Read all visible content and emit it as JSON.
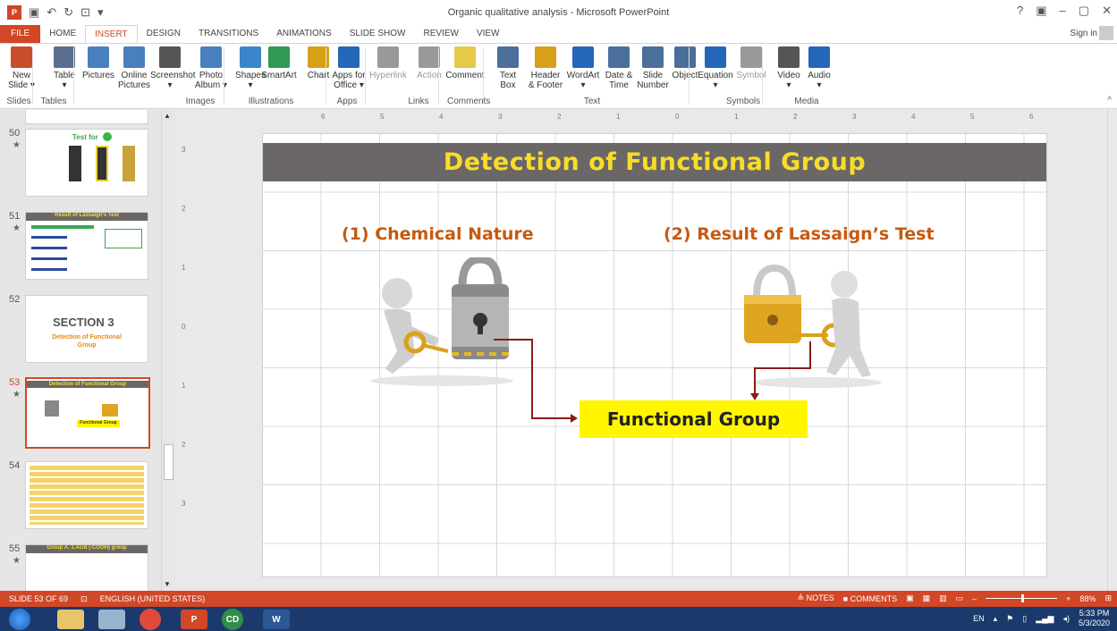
{
  "window": {
    "title": "Organic qualitative analysis - Microsoft PowerPoint",
    "controls": [
      "?",
      "▣",
      "–",
      "▢",
      "✕"
    ]
  },
  "tabs": [
    "FILE",
    "HOME",
    "INSERT",
    "DESIGN",
    "TRANSITIONS",
    "ANIMATIONS",
    "SLIDE SHOW",
    "REVIEW",
    "VIEW"
  ],
  "active_tab": "INSERT",
  "sign_in": "Sign in",
  "ribbon": {
    "buttons": [
      {
        "l1": "New",
        "l2": "Slide ▾",
        "color": "#c94f2a"
      },
      {
        "l1": "Table",
        "l2": "▾",
        "color": "#5a6f8f"
      },
      {
        "l1": "Pictures",
        "l2": "",
        "color": "#4a7fbf"
      },
      {
        "l1": "Online",
        "l2": "Pictures",
        "color": "#4a7fbf"
      },
      {
        "l1": "Screenshot",
        "l2": "▾",
        "color": "#555"
      },
      {
        "l1": "Photo",
        "l2": "Album ▾",
        "color": "#4a7fbf"
      },
      {
        "l1": "Shapes",
        "l2": "▾",
        "color": "#3a86c8"
      },
      {
        "l1": "SmartArt",
        "l2": "",
        "color": "#2e9a55"
      },
      {
        "l1": "Chart",
        "l2": "",
        "color": "#d7a018"
      },
      {
        "l1": "Apps for",
        "l2": "Office ▾",
        "color": "#2466b8"
      },
      {
        "l1": "Hyperlink",
        "l2": "",
        "color": "#999"
      },
      {
        "l1": "Action",
        "l2": "",
        "color": "#999"
      },
      {
        "l1": "Comment",
        "l2": "",
        "color": "#e4c94a"
      },
      {
        "l1": "Text",
        "l2": "Box",
        "color": "#4a6f9a"
      },
      {
        "l1": "Header",
        "l2": "& Footer",
        "color": "#d7a018"
      },
      {
        "l1": "WordArt",
        "l2": "▾",
        "color": "#2466b8"
      },
      {
        "l1": "Date &",
        "l2": "Time",
        "color": "#4a6f9a"
      },
      {
        "l1": "Slide",
        "l2": "Number",
        "color": "#4a6f9a"
      },
      {
        "l1": "Object",
        "l2": "",
        "color": "#4a6f9a"
      },
      {
        "l1": "Equation",
        "l2": "▾",
        "color": "#2466b8"
      },
      {
        "l1": "Symbol",
        "l2": "",
        "color": "#999"
      },
      {
        "l1": "Video",
        "l2": "▾",
        "color": "#555"
      },
      {
        "l1": "Audio",
        "l2": "▾",
        "color": "#2466b8"
      }
    ],
    "groups": [
      "Slides",
      "Tables",
      "Images",
      "Illustrations",
      "Apps",
      "Links",
      "Comments",
      "Text",
      "Symbols",
      "Media"
    ]
  },
  "thumbnails": [
    {
      "number": "50",
      "star": "★",
      "caption": "Test for"
    },
    {
      "number": "51",
      "star": "★",
      "caption": "Result of Lassaign's Test"
    },
    {
      "number": "52",
      "star": "",
      "caption": "SECTION 3"
    },
    {
      "number": "53",
      "star": "★",
      "caption": "Detection of Functional Group"
    },
    {
      "number": "54",
      "star": "",
      "caption": ""
    },
    {
      "number": "55",
      "star": "★",
      "caption": "Group A. 1.Acid (-COOH) group"
    }
  ],
  "thumb_texts": {
    "s52_sub": "Detection of Functional Group",
    "s53_fg": "Functional Group"
  },
  "slide": {
    "title": "Detection of Functional Group",
    "left_heading": "(1) Chemical Nature",
    "right_heading": "(2) Result of Lassaign’s Test",
    "callout": "Functional Group"
  },
  "ruler": {
    "h": [
      "6",
      "5",
      "4",
      "3",
      "2",
      "1",
      "0",
      "1",
      "2",
      "3",
      "4",
      "5",
      "6"
    ],
    "v": [
      "3",
      "2",
      "1",
      "0",
      "1",
      "2",
      "3"
    ]
  },
  "status": {
    "slide_count": "SLIDE 53 OF 69",
    "language": "ENGLISH (UNITED STATES)",
    "notes": "≜ NOTES",
    "comments": "COMMENTS",
    "zoom": "88%"
  },
  "taskbar": {
    "lang": "EN",
    "time": "5:33 PM",
    "date": "5/3/2020"
  }
}
